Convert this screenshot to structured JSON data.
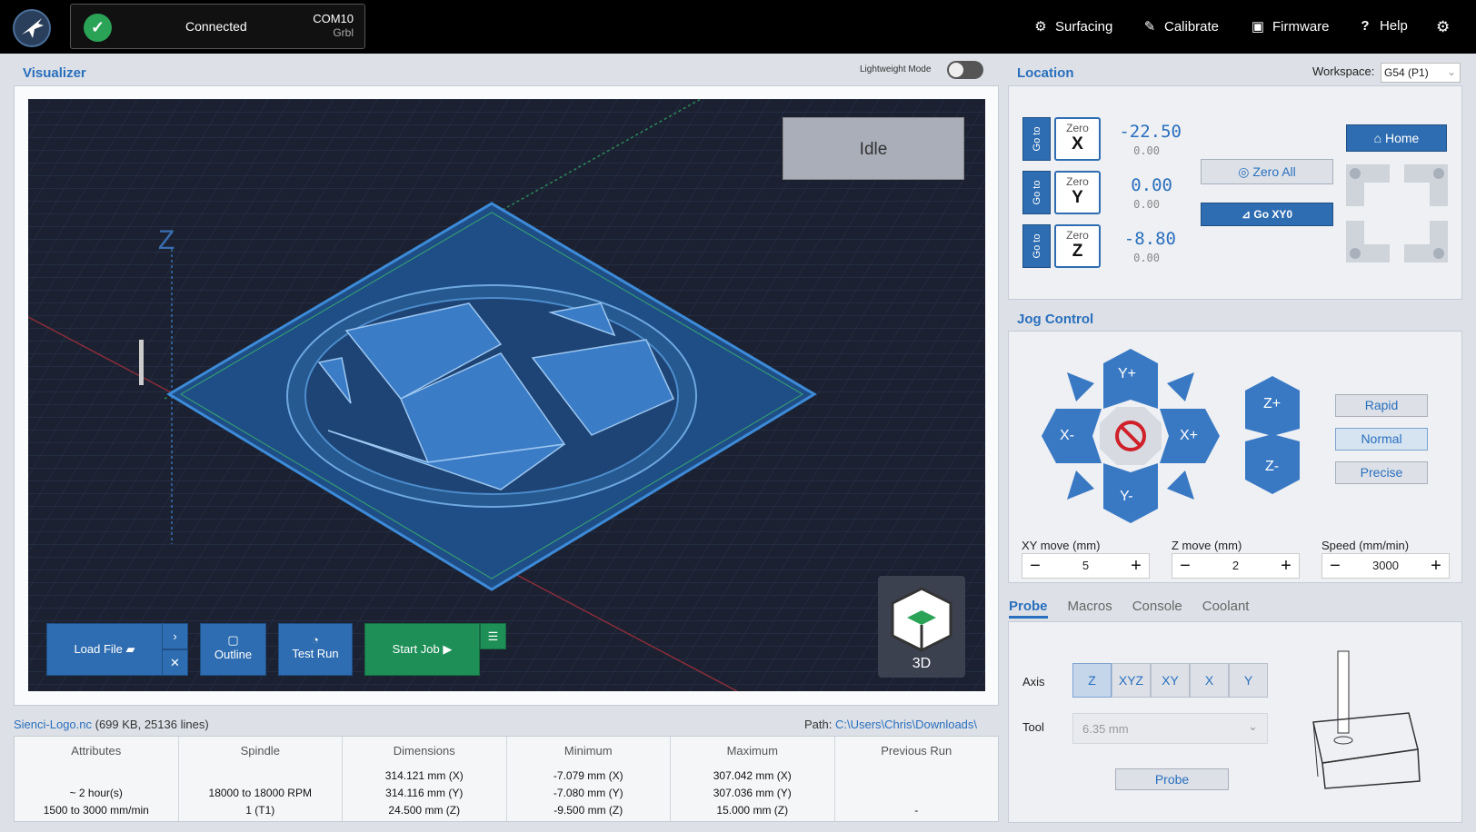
{
  "header": {
    "connection_status": "Connected",
    "port": "COM10",
    "firmware_type": "Grbl",
    "nav": [
      "Surfacing",
      "Calibrate",
      "Firmware",
      "Help"
    ]
  },
  "visualizer": {
    "title": "Visualizer",
    "lightweight_label": "Lightweight Mode",
    "state": "Idle",
    "axis_label": "Z",
    "view_label": "3D",
    "buttons": {
      "load_file": "Load File",
      "outline": "Outline",
      "test_run": "Test Run",
      "start_job": "Start Job"
    }
  },
  "file": {
    "name": "Sienci-Logo.nc",
    "meta": "(699 KB, 25136 lines)",
    "path_label": "Path:",
    "path": "C:\\Users\\Chris\\Downloads\\"
  },
  "info": {
    "columns": [
      {
        "header": "Attributes",
        "lines": [
          "~ 2 hour(s)",
          "1500 to 3000 mm/min"
        ]
      },
      {
        "header": "Spindle",
        "lines": [
          "18000 to 18000 RPM",
          "1 (T1)"
        ]
      },
      {
        "header": "Dimensions",
        "lines": [
          "314.121 mm (X)",
          "314.116 mm (Y)",
          "24.500 mm (Z)"
        ]
      },
      {
        "header": "Minimum",
        "lines": [
          "-7.079 mm (X)",
          "-7.080 mm (Y)",
          "-9.500 mm (Z)"
        ]
      },
      {
        "header": "Maximum",
        "lines": [
          "307.042 mm (X)",
          "307.036 mm (Y)",
          "15.000 mm (Z)"
        ]
      },
      {
        "header": "Previous Run",
        "lines": [
          "-"
        ]
      }
    ]
  },
  "location": {
    "title": "Location",
    "workspace_label": "Workspace:",
    "workspace_value": "G54 (P1)",
    "goto_label": "Go to",
    "zero_label": "Zero",
    "axes": [
      {
        "axis": "X",
        "work": "-22.50",
        "machine": "0.00"
      },
      {
        "axis": "Y",
        "work": "0.00",
        "machine": "0.00"
      },
      {
        "axis": "Z",
        "work": "-8.80",
        "machine": "0.00"
      }
    ],
    "zero_all": "Zero All",
    "go_xy0": "Go  XY0",
    "home": "Home"
  },
  "jog": {
    "title": "Jog Control",
    "yplus": "Y+",
    "yminus": "Y-",
    "xplus": "X+",
    "xminus": "X-",
    "zplus": "Z+",
    "zminus": "Z-",
    "speeds": [
      "Rapid",
      "Normal",
      "Precise"
    ],
    "xy_label": "XY move (mm)",
    "xy_value": "5",
    "z_label": "Z move (mm)",
    "z_value": "2",
    "speed_label": "Speed (mm/min)",
    "speed_value": "3000"
  },
  "tabs": [
    "Probe",
    "Macros",
    "Console",
    "Coolant"
  ],
  "probe": {
    "axis_label": "Axis",
    "axes": [
      "Z",
      "XYZ",
      "XY",
      "X",
      "Y"
    ],
    "tool_label": "Tool",
    "tool_value": "6.35 mm",
    "probe_button": "Probe"
  }
}
